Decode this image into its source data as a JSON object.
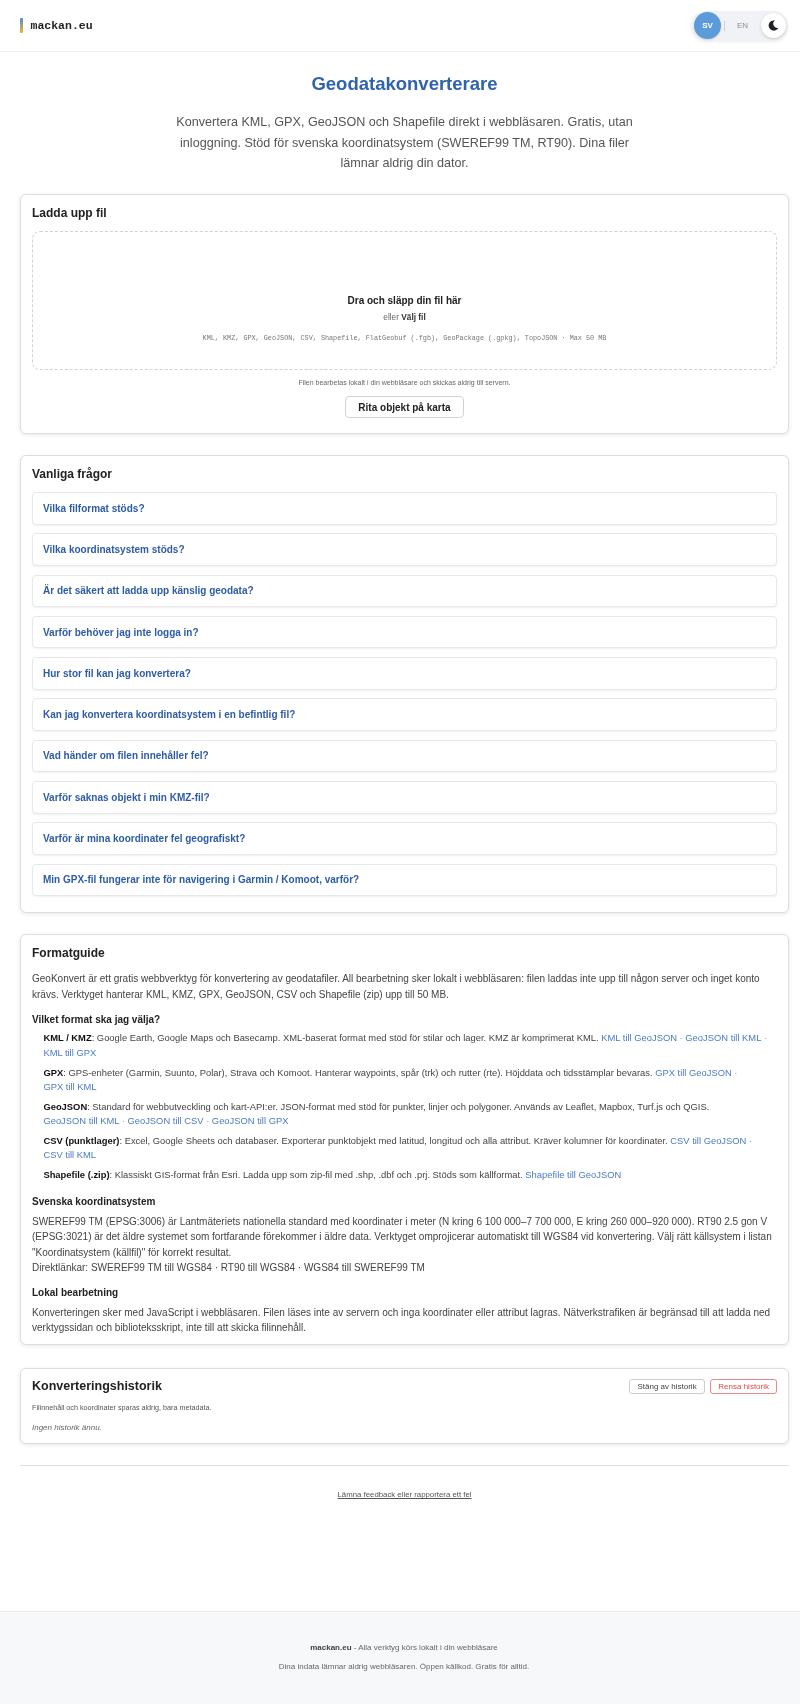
{
  "header": {
    "logo": "mackan.eu",
    "language_options": [
      {
        "label": "SV",
        "selected": true
      },
      {
        "label": "EN",
        "selected": false
      }
    ]
  },
  "intro": {
    "title": "Geodatakonverterare",
    "subtitle": "Konvertera KML, GPX, GeoJSON och Shapefile direkt i webbläsaren. Gratis, utan inloggning. Stöd för svenska koordinatsystem (SWEREF99 TM, RT90). Dina filer lämnar aldrig din dator."
  },
  "upload": {
    "title": "Ladda upp fil",
    "drop_title": "Dra och släpp din fil här",
    "drop_hint": "eller",
    "choose_file": "Välj fil",
    "formats": "KML, KMZ, GPX, GeoJSON, CSV, Shapefile, FlatGeobuf (.fgb), GeoPackage (.gpkg), TopoJSON · Max 50 MB",
    "privacy_note": "Filen bearbetas lokalt i din webbläsare och skickas aldrig till servern.",
    "draw_button": "Rita objekt på karta"
  },
  "faq": {
    "title": "Vanliga frågor",
    "questions": [
      "Vilka filformat stöds?",
      "Vilka koordinatsystem stöds?",
      "Är det säkert att ladda upp känslig geodata?",
      "Varför behöver jag inte logga in?",
      "Hur stor fil kan jag konvertera?",
      "Kan jag konvertera koordinatsystem i en befintlig fil?",
      "Vad händer om filen innehåller fel?",
      "Varför saknas objekt i min KMZ-fil?",
      "Varför är mina koordinater fel geografiskt?",
      "Min GPX-fil fungerar inte för navigering i Garmin / Komoot, varför?"
    ]
  },
  "format_guide": {
    "title": "Formatguide",
    "intro": "GeoKonvert är ett gratis webbverktyg för konvertering av geodatafiler. All bearbetning sker lokalt i webbläsaren: filen laddas inte upp till någon server och inget konto krävs. Verktyget hanterar KML, KMZ, GPX, GeoJSON, CSV och Shapefile (zip) upp till 50 MB.",
    "choose_heading": "Vilket format ska jag välja?",
    "link_separator": "·",
    "formats": [
      {
        "text": "**KML / KMZ**: Google Earth, Google Maps och Basecamp. XML-baserat format med stöd för stilar och lager. KMZ är komprimerat KML.",
        "links": [
          "KML till GeoJSON",
          "GeoJSON till KML",
          "KML till GPX"
        ]
      },
      {
        "text": "**GPX**: GPS-enheter (Garmin, Suunto, Polar), Strava och Komoot. Hanterar waypoints, spår (trk) och rutter (rte). Höjddata och tidsstämplar bevaras.",
        "links": [
          "GPX till GeoJSON",
          "GPX till KML"
        ]
      },
      {
        "text": "**GeoJSON**: Standard för webbutveckling och kart-API:er. JSON-format med stöd för punkter, linjer och polygoner. Används av Leaflet, Mapbox, Turf.js och QGIS.",
        "links": [
          "GeoJSON till KML",
          "GeoJSON till CSV",
          "GeoJSON till GPX"
        ]
      },
      {
        "text": "**CSV (punktlager)**: Excel, Google Sheets och databaser. Exporterar punktobjekt med latitud, longitud och alla attribut. Kräver kolumner för koordinater.",
        "links": [
          "CSV till GeoJSON",
          "CSV till KML"
        ]
      },
      {
        "text": "**Shapefile (.zip)**: Klassiskt GIS-format från Esri. Ladda upp som zip-fil med .shp, .dbf och .prj. Stöds som källformat.",
        "links": [
          "Shapefile till GeoJSON"
        ]
      }
    ],
    "crs_heading": "Svenska koordinatsystem",
    "crs_paragraphs": [
      "SWEREF99 TM (EPSG:3006) är Lantmäteriets nationella standard med koordinater i meter (N kring 6 100 000–7 700 000, E kring 260 000–920 000). RT90 2.5 gon V (EPSG:3021) är det äldre systemet som fortfarande förekommer i äldre data. Verktyget omprojicerar automatiskt till WGS84 vid konvertering. Välj rätt källsystem i listan \"Koordinatsystem (källfil)\" för korrekt resultat.",
      "Direktlänkar: SWEREF99 TM till WGS84 · RT90 till WGS84 · WGS84 till SWEREF99 TM"
    ],
    "local_heading": "Lokal bearbetning",
    "local_text": "Konverteringen sker med JavaScript i webbläsaren. Filen läses inte av servern och inga koordinater eller attribut lagras. Nätverkstrafiken är begränsad till att ladda ned verktygssidan och biblioteksskript, inte till att skicka filinnehåll."
  },
  "history": {
    "title": "Konverteringshistorik",
    "buttons": [
      {
        "label": "Stäng av historik",
        "kind": "neutral"
      },
      {
        "label": "Rensa historik",
        "kind": "danger"
      }
    ],
    "note": "Filinnehåll och koordinater sparas aldrig, bara metadata.",
    "empty": "Ingen historik ännu."
  },
  "feedback_link": "Lämna feedback eller rapportera ett fel",
  "footer": {
    "lines": [
      "**mackan.eu** - Alla verktyg körs lokalt i din webbläsare",
      "Dina indata lämnar aldrig webbläsaren. Öppen källkod. Gratis för alltid."
    ]
  }
}
